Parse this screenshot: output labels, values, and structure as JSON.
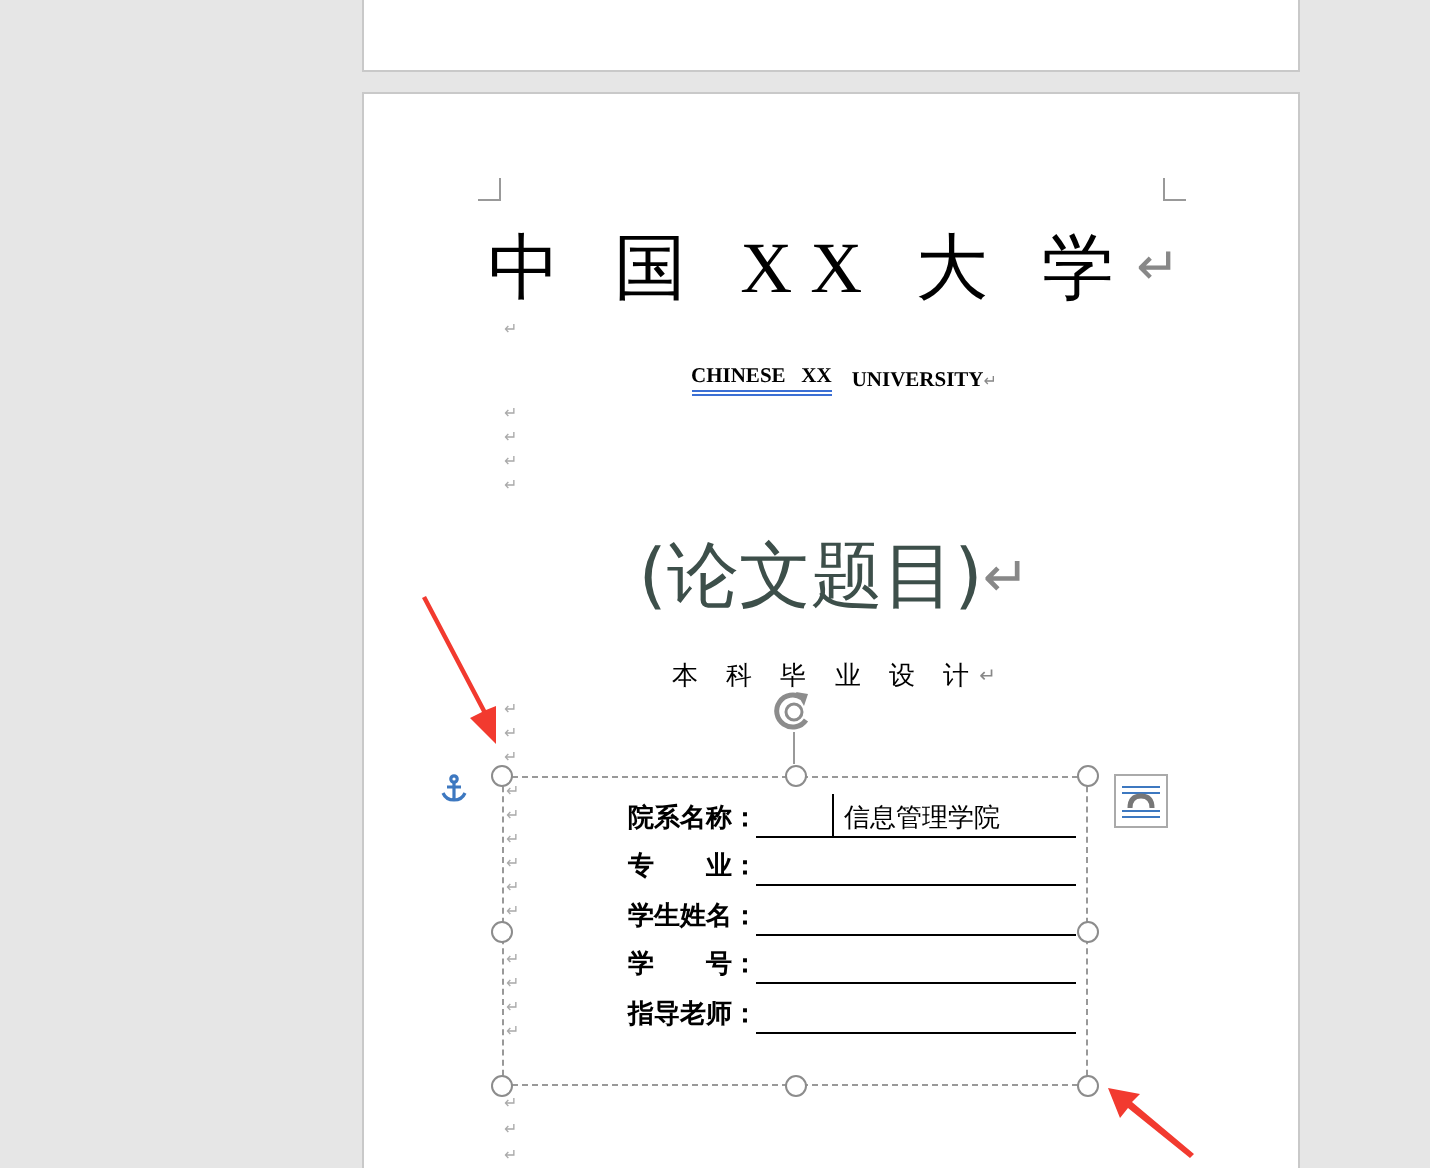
{
  "title": {
    "text": "中 国 XX 大 学",
    "mark": "↵"
  },
  "blank_marks_1": [
    "↵"
  ],
  "english_title": {
    "segments": [
      {
        "text": "CHINESE   XX",
        "spell_flagged": true
      },
      {
        "text": "UNIVERSITY",
        "spell_flagged": false
      }
    ],
    "mark": "↵"
  },
  "blank_marks_2": [
    "↵",
    "↵",
    "↵",
    "↵"
  ],
  "thesis_title": {
    "text": "(论文题目)",
    "mark": "↵"
  },
  "subtitle": {
    "text": "本 科 毕 业 设 计",
    "mark": "↵"
  },
  "blank_marks_3": [
    "↵",
    "↵",
    "↵"
  ],
  "text_box": {
    "selected": true,
    "paragraph_marks": [
      "↵",
      "↵",
      "↵",
      "↵",
      "↵",
      "↵",
      "↵",
      "↵",
      "↵",
      "↵"
    ],
    "fields": [
      {
        "label": "院系名称：",
        "value": "信息管理学院",
        "cursor": true
      },
      {
        "label": "专　　业：",
        "cursor": false
      },
      {
        "label": "学生姓名：",
        "cursor": false
      },
      {
        "label": "学　　号：",
        "cursor": false
      },
      {
        "label": "指导老师：",
        "cursor": false
      }
    ]
  },
  "blank_marks_4": [
    "↵",
    "↵",
    "↵"
  ]
}
